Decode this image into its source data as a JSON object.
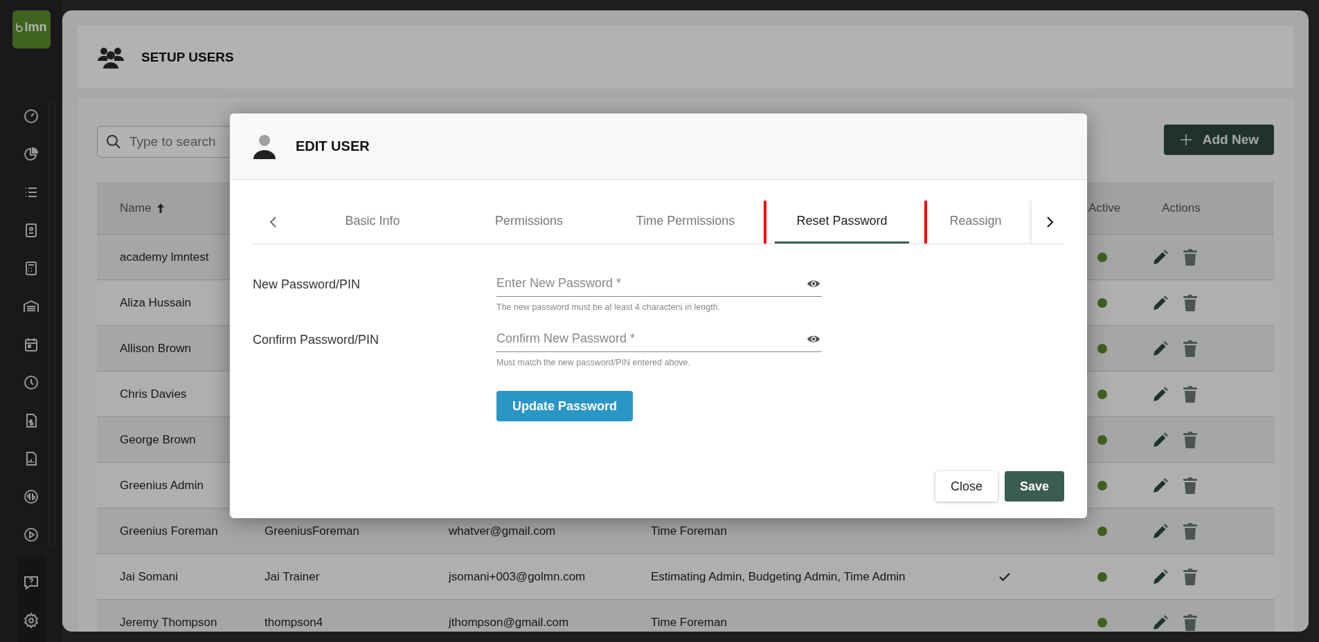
{
  "sidebar": {
    "logo": "lmn"
  },
  "page": {
    "title": "SETUP USERS",
    "search": {
      "placeholder": "Type to search"
    },
    "add_button": "Add New"
  },
  "table": {
    "columns": [
      {
        "label": "Name",
        "sorted": true
      },
      {
        "label": "Active",
        "sorted": false
      },
      {
        "label": "Actions",
        "sorted": false
      }
    ],
    "rows": [
      {
        "name": "academy lmntest",
        "active": true
      },
      {
        "name": "Aliza Hussain",
        "active": true
      },
      {
        "name": "Allison Brown",
        "active": true
      },
      {
        "name": "Chris Davies",
        "active": true
      },
      {
        "name": "George Brown",
        "active": true
      },
      {
        "name": "Greenius Admin",
        "active": true
      },
      {
        "name": "Greenius Foreman",
        "username": "GreeniusForeman",
        "email": "whatver@gmail.com",
        "roles": "Time Foreman",
        "checked": false,
        "active": true
      },
      {
        "name": "Jai Somani",
        "username": "Jai Trainer",
        "email": "jsomani+003@golmn.com",
        "roles": "Estimating Admin, Budgeting Admin, Time Admin",
        "checked": true,
        "active": true
      },
      {
        "name": "Jeremy Thompson",
        "username": "thompson4",
        "email": "jthompson@gmail.com",
        "roles": "Time Foreman",
        "checked": false,
        "active": true
      }
    ]
  },
  "modal": {
    "title": "EDIT USER",
    "tabs": [
      {
        "label": "Basic Info",
        "selected": false,
        "annotated": false
      },
      {
        "label": "Permissions",
        "selected": false,
        "annotated": false
      },
      {
        "label": "Time Permissions",
        "selected": false,
        "annotated": false
      },
      {
        "label": "Reset Password",
        "selected": true,
        "annotated": true
      },
      {
        "label": "Reassign",
        "selected": false,
        "annotated": false
      }
    ],
    "fields": [
      {
        "label": "New Password/PIN",
        "placeholder": "Enter New Password *",
        "hint": "The new password must be at least 4 characters in length."
      },
      {
        "label": "Confirm Password/PIN",
        "placeholder": "Confirm New Password *",
        "hint": "Must match the new password/PIN entered above."
      }
    ],
    "update_button": "Update Password",
    "buttons": [
      {
        "label": "Close",
        "kind": "secondary"
      },
      {
        "label": "Save",
        "kind": "primary"
      }
    ]
  }
}
